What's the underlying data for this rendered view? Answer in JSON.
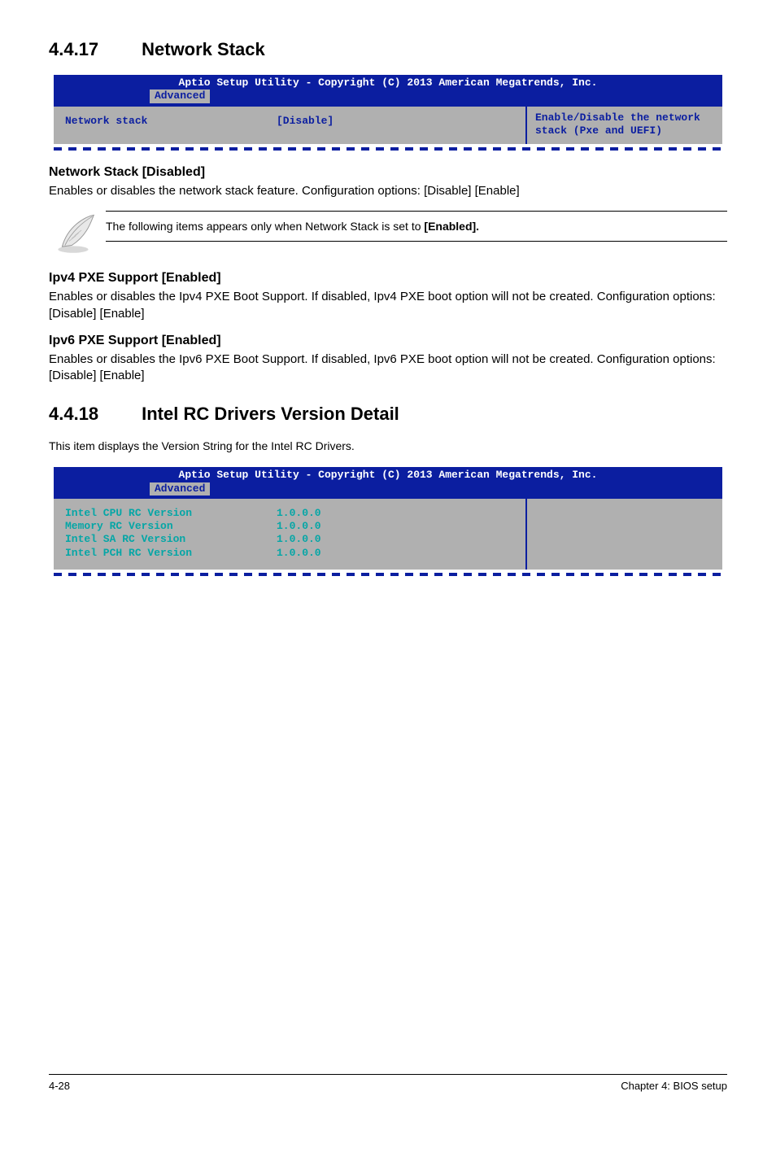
{
  "section1": {
    "number": "4.4.17",
    "title": "Network Stack"
  },
  "bios1": {
    "title": "Aptio Setup Utility - Copyright (C) 2013 American Megatrends, Inc.",
    "tab": "Advanced",
    "row": {
      "label": "Network stack",
      "value": "[Disable]"
    },
    "help": "Enable/Disable the network stack (Pxe and UEFI)"
  },
  "para1_heading": "Network Stack [Disabled]",
  "para1_body": "Enables or disables the network stack feature. Configuration options: [Disable] [Enable]",
  "note_text_prefix": "The following items appears only when Network Stack is set to ",
  "note_text_bold": "[Enabled].",
  "para2_heading": "Ipv4 PXE Support [Enabled]",
  "para2_body": "Enables or disables the Ipv4 PXE Boot Support. If disabled, Ipv4 PXE boot option will not be created. Configuration options: [Disable] [Enable]",
  "para3_heading": "Ipv6 PXE Support [Enabled]",
  "para3_body": "Enables or disables the Ipv6 PXE Boot Support. If disabled, Ipv6 PXE boot option will not be created. Configuration options: [Disable] [Enable]",
  "section2": {
    "number": "4.4.18",
    "title": "Intel RC Drivers Version Detail"
  },
  "section2_body": "This item displays the Version String for the Intel RC Drivers.",
  "bios2": {
    "title": "Aptio Setup Utility - Copyright (C) 2013 American Megatrends, Inc.",
    "tab": "Advanced",
    "rows": [
      {
        "label": "Intel CPU RC Version",
        "value": "1.0.0.0"
      },
      {
        "label": "Memory RC Version",
        "value": "1.0.0.0"
      },
      {
        "label": "Intel SA RC Version",
        "value": "1.0.0.0"
      },
      {
        "label": "Intel PCH RC Version",
        "value": "1.0.0.0"
      }
    ]
  },
  "footer": {
    "left": "4-28",
    "right": "Chapter 4: BIOS setup"
  }
}
